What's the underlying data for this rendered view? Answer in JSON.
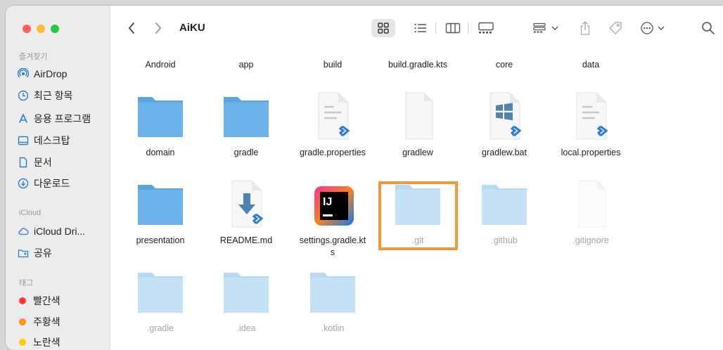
{
  "window": {
    "title": "AiKU"
  },
  "sidebar": {
    "favorites_label": "즐겨찾기",
    "favorites": [
      {
        "label": "AirDrop",
        "icon": "airdrop-icon"
      },
      {
        "label": "최근 항목",
        "icon": "clock-icon"
      },
      {
        "label": "응용 프로그램",
        "icon": "applications-icon"
      },
      {
        "label": "데스크탑",
        "icon": "desktop-icon"
      },
      {
        "label": "문서",
        "icon": "document-icon"
      },
      {
        "label": "다운로드",
        "icon": "download-icon"
      }
    ],
    "icloud_label": "iCloud",
    "icloud": [
      {
        "label": "iCloud Dri...",
        "icon": "cloud-icon"
      },
      {
        "label": "공유",
        "icon": "shared-folder-icon"
      }
    ],
    "tags_label": "태그",
    "tags": [
      {
        "label": "빨간색",
        "color": "#ff3b30"
      },
      {
        "label": "주황색",
        "color": "#ff9500"
      },
      {
        "label": "노란색",
        "color": "#ffcc00"
      }
    ]
  },
  "toolbar": {
    "back": "back-icon",
    "forward": "forward-icon",
    "views": [
      "icon-view-icon",
      "list-view-icon",
      "column-view-icon",
      "gallery-view-icon"
    ],
    "group": "group-icon",
    "share": "share-icon",
    "tag": "tag-icon",
    "more": "more-icon",
    "search": "search-icon"
  },
  "files": {
    "row0": [
      "Android",
      "app",
      "build",
      "build.gradle.kts",
      "core",
      "data"
    ],
    "row1": [
      {
        "name": "domain",
        "type": "folder"
      },
      {
        "name": "gradle",
        "type": "folder"
      },
      {
        "name": "gradle.properties",
        "type": "text-doc"
      },
      {
        "name": "gradlew",
        "type": "blank-doc"
      },
      {
        "name": "gradlew.bat",
        "type": "windows-doc"
      },
      {
        "name": "local.properties",
        "type": "text-doc"
      }
    ],
    "row2": [
      {
        "name": "presentation",
        "type": "folder"
      },
      {
        "name": "README.md",
        "type": "markdown-doc"
      },
      {
        "name": "settings.gradle.kts",
        "type": "intellij-doc",
        "line1": "settings.gradle.kt",
        "line2": "s"
      },
      {
        "name": ".git",
        "type": "folder-hidden"
      },
      {
        "name": ".github",
        "type": "folder-hidden"
      },
      {
        "name": ".gitignore",
        "type": "blank-doc-hidden"
      }
    ],
    "row3": [
      {
        "name": ".gradle",
        "type": "folder-hidden"
      },
      {
        "name": ".idea",
        "type": "folder-hidden"
      },
      {
        "name": ".kotlin",
        "type": "folder-hidden"
      }
    ]
  },
  "intellij_logo_text": "IJ",
  "colors": {
    "folder": "#6db3ea",
    "folder_dark": "#5aa3de",
    "highlight": "#ef9a3a",
    "vscode": "#2a7fd4"
  }
}
